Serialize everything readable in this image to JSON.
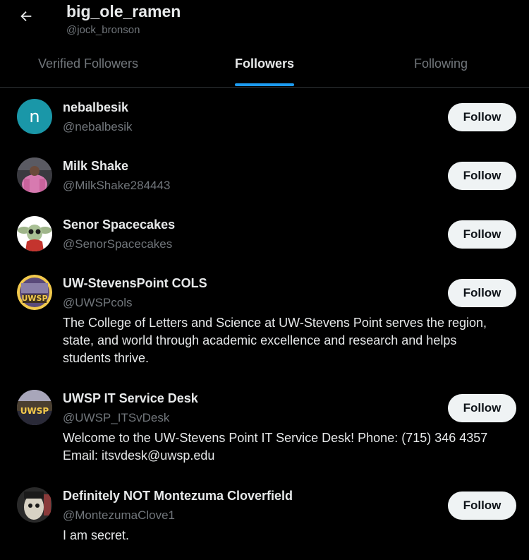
{
  "header": {
    "title": "big_ole_ramen",
    "subtitle": "@jock_bronson"
  },
  "tabs": [
    {
      "label": "Verified Followers",
      "active": false
    },
    {
      "label": "Followers",
      "active": true
    },
    {
      "label": "Following",
      "active": false
    }
  ],
  "colors": {
    "accent": "#1d9bf0",
    "background": "#000000",
    "muted_text": "#71767b",
    "primary_text": "#e7e9ea",
    "button_bg": "#eff3f4"
  },
  "followers": [
    {
      "name": "nebalbesik",
      "handle": "@nebalbesik",
      "bio": [],
      "follow_label": "Follow",
      "avatar_letter": "n",
      "avatar_color": "#1a97a8"
    },
    {
      "name": "Milk Shake",
      "handle": "@MilkShake284443",
      "bio": [],
      "follow_label": "Follow"
    },
    {
      "name": "Senor Spacecakes",
      "handle": "@SenorSpacecakes",
      "bio": [],
      "follow_label": "Follow"
    },
    {
      "name": "UW-StevensPoint COLS",
      "handle": "@UWSPcols",
      "bio": [
        "The College of Letters and Science at UW-Stevens Point serves the region,",
        "state, and world through academic excellence and research and helps",
        "students thrive."
      ],
      "follow_label": "Follow",
      "avatar_text": "UWSP"
    },
    {
      "name": "UWSP IT Service Desk",
      "handle": "@UWSP_ITSvDesk",
      "bio": [
        "Welcome to the UW-Stevens Point IT Service Desk! Phone: (715) 346 4357",
        "Email: itsvdesk@uwsp.edu"
      ],
      "follow_label": "Follow",
      "avatar_text": "UWSP"
    },
    {
      "name": "Definitely NOT Montezuma Cloverfield",
      "handle": "@MontezumaClove1",
      "bio": [
        "I am secret."
      ],
      "follow_label": "Follow"
    }
  ]
}
